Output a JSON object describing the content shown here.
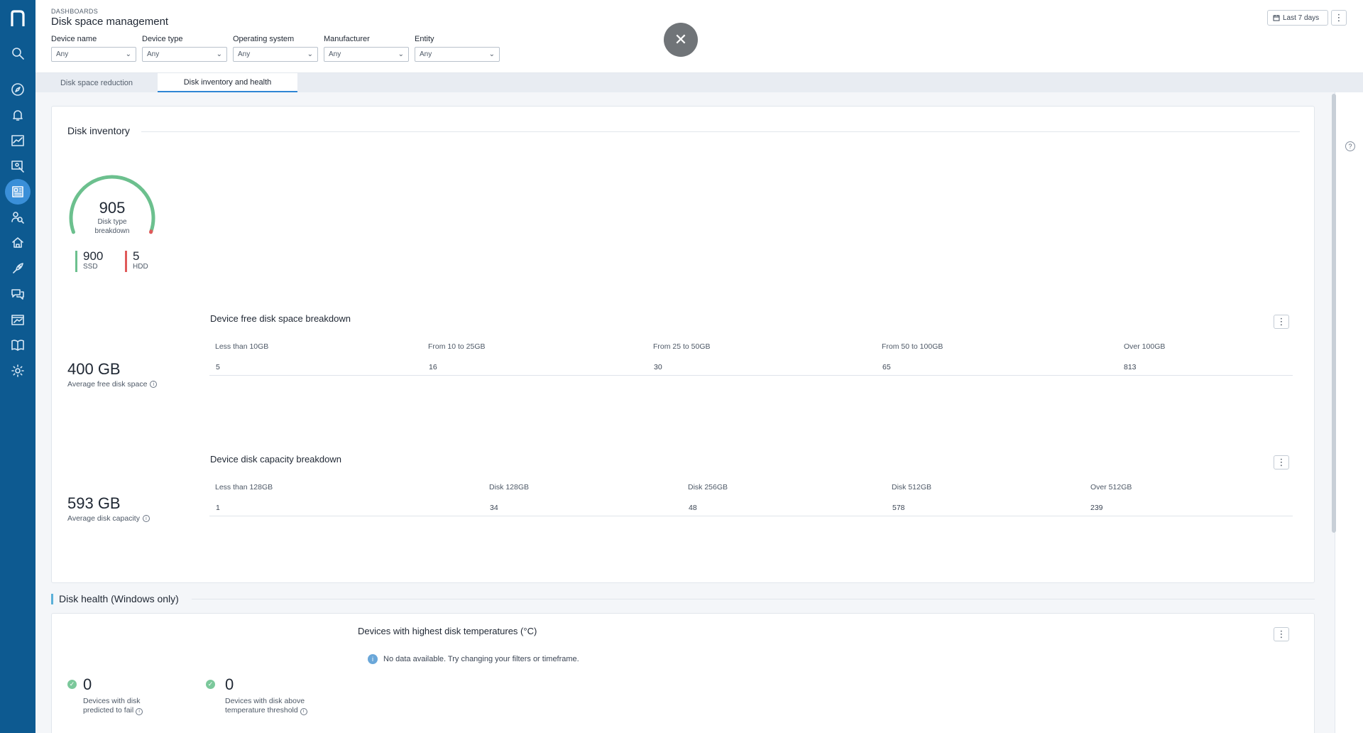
{
  "header": {
    "breadcrumb": "DASHBOARDS",
    "title": "Disk space management",
    "timeframe": "Last 7 days",
    "filters": [
      {
        "label": "Device name",
        "value": "Any"
      },
      {
        "label": "Device type",
        "value": "Any"
      },
      {
        "label": "Operating system",
        "value": "Any"
      },
      {
        "label": "Manufacturer",
        "value": "Any"
      },
      {
        "label": "Entity",
        "value": "Any"
      }
    ]
  },
  "tabs": [
    {
      "label": "Disk space reduction",
      "active": false
    },
    {
      "label": "Disk inventory and health",
      "active": true
    }
  ],
  "inventory": {
    "title": "Disk inventory",
    "gauge": {
      "total": "905",
      "label_line1": "Disk type",
      "label_line2": "breakdown",
      "ssd_share": 0.9945
    },
    "legend": [
      {
        "value": "900",
        "label": "SSD",
        "color": "#6cc08e"
      },
      {
        "value": "5",
        "label": "HDD",
        "color": "#e05a5a"
      }
    ],
    "free_space": {
      "kpi_value": "400 GB",
      "kpi_label": "Average free disk space",
      "table_title": "Device free disk space breakdown",
      "headers": [
        "Less than 10GB",
        "From 10 to 25GB",
        "From 25 to 50GB",
        "From 50 to 100GB",
        "Over 100GB"
      ],
      "values": [
        "5",
        "16",
        "30",
        "65",
        "813"
      ]
    },
    "capacity": {
      "kpi_value": "593 GB",
      "kpi_label": "Average disk capacity",
      "table_title": "Device disk capacity breakdown",
      "headers": [
        "Less than 128GB",
        "Disk 128GB",
        "Disk 256GB",
        "Disk 512GB",
        "Over 512GB"
      ],
      "values": [
        "1",
        "34",
        "48",
        "578",
        "239"
      ]
    }
  },
  "health": {
    "title": "Disk health (Windows only)",
    "kpis": [
      {
        "value": "0",
        "line1": "Devices with disk",
        "line2": "predicted to fail"
      },
      {
        "value": "0",
        "line1": "Devices with disk above",
        "line2": "temperature threshold"
      }
    ],
    "chart_title": "Devices with highest disk temperatures (°C)",
    "no_data": "No data available. Try changing your filters or timeframe."
  },
  "colors": {
    "sidebar": "#0d5a91",
    "accent": "#2f86d4",
    "ssd": "#6cc08e",
    "hdd": "#e05a5a"
  }
}
